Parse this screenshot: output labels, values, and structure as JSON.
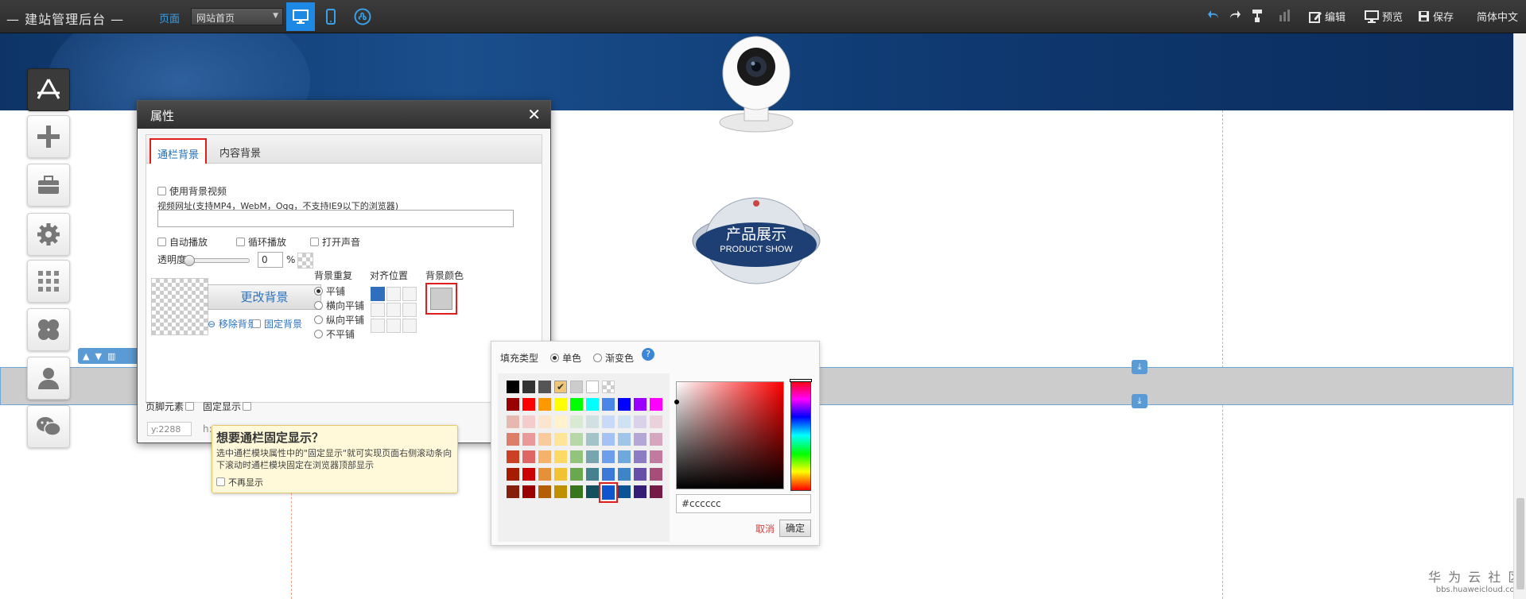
{
  "app": {
    "title": "— 建站管理后台 —"
  },
  "toolbar": {
    "page_label": "页面",
    "page_select": "网站首页",
    "right_tools": [
      {
        "icon": "undo-icon",
        "label": ""
      },
      {
        "icon": "redo-icon",
        "label": ""
      },
      {
        "icon": "paint-roller-icon",
        "label": ""
      },
      {
        "icon": "bar-chart-icon",
        "label": ""
      },
      {
        "icon": "edit-icon",
        "label": "编辑"
      },
      {
        "icon": "monitor-icon",
        "label": "预览"
      },
      {
        "icon": "save-icon",
        "label": "保存"
      },
      {
        "icon": "",
        "label": "简体中文"
      }
    ]
  },
  "canvas": {
    "product_badge": {
      "title": "产品展示",
      "subtitle": "PRODUCT SHOW"
    }
  },
  "dialog": {
    "title": "属性",
    "tabs": [
      "通栏背景",
      "内容背景"
    ],
    "use_video": "使用背景视频",
    "video_url_label": "视频网址(支持MP4，WebM，Ogg，不支持IE9以下的浏览器)",
    "autoplay": "自动播放",
    "loop": "循环播放",
    "sound": "打开声音",
    "opacity_label": "透明度",
    "opacity_value": "0",
    "opacity_unit": "%",
    "change_bg": "更改背景",
    "remove_bg": "移除背景",
    "fixed_bg": "固定背景",
    "repeat_label": "背景重复",
    "repeat_options": [
      "平铺",
      "横向平铺",
      "纵向平铺",
      "不平铺"
    ],
    "repeat_selected": "平铺",
    "align_label": "对齐位置",
    "bgcolor_label": "背景颜色",
    "bgcolor_value": "#cccccc",
    "footer_element": "页脚元素",
    "fixed_display": "固定显示",
    "coord_y": "y:2288",
    "coord_h": "h:"
  },
  "tooltip": {
    "title": "想要通栏固定显示？",
    "body": "选中通栏模块属性中的\"固定显示\"就可实现页面右侧滚动条向下滚动时通栏模块固定在浏览器顶部显示",
    "dont_show": "不再显示"
  },
  "color_picker": {
    "fill_type_label": "填充类型",
    "solid": "单色",
    "gradient": "渐变色",
    "help": "?",
    "hex_value": "#cccccc",
    "cancel": "取消",
    "ok": "确定",
    "swatch_rows": [
      [
        "#000000",
        "#333333",
        "#555555",
        "#f0c678",
        "#cccccc",
        "#ffffff",
        "checker"
      ],
      [
        "#990000",
        "#ff0000",
        "#ff9900",
        "#ffff00",
        "#00ff00",
        "#00ffff",
        "#4a86e8",
        "#0000ff",
        "#9900ff",
        "#ff00ff"
      ],
      [
        "#e6b8af",
        "#f4cccc",
        "#fce5cd",
        "#fff2cc",
        "#d9ead3",
        "#d0e0e3",
        "#c9daf8",
        "#cfe2f3",
        "#d9d2e9",
        "#ead1dc"
      ],
      [
        "#dd7e6b",
        "#ea9999",
        "#f9cb9c",
        "#ffe599",
        "#b6d7a8",
        "#a2c4c9",
        "#a4c2f4",
        "#9fc5e8",
        "#b4a7d6",
        "#d5a6bd"
      ],
      [
        "#cc4125",
        "#e06666",
        "#f6b26b",
        "#ffd966",
        "#93c47d",
        "#76a5af",
        "#6d9eeb",
        "#6fa8dc",
        "#8e7cc3",
        "#c27ba0"
      ],
      [
        "#a61c00",
        "#cc0000",
        "#e69138",
        "#f1c232",
        "#6aa84f",
        "#45818e",
        "#3c78d8",
        "#3d85c6",
        "#674ea7",
        "#a64d79"
      ],
      [
        "#85200c",
        "#990000",
        "#b45f06",
        "#bf9000",
        "#38761d",
        "#134f5c",
        "#1155cc",
        "#0b5394",
        "#351c75",
        "#741b47"
      ]
    ]
  },
  "watermark": {
    "line1": "华 为 云 社 区",
    "line2": "bbs.huaweicloud.com"
  }
}
